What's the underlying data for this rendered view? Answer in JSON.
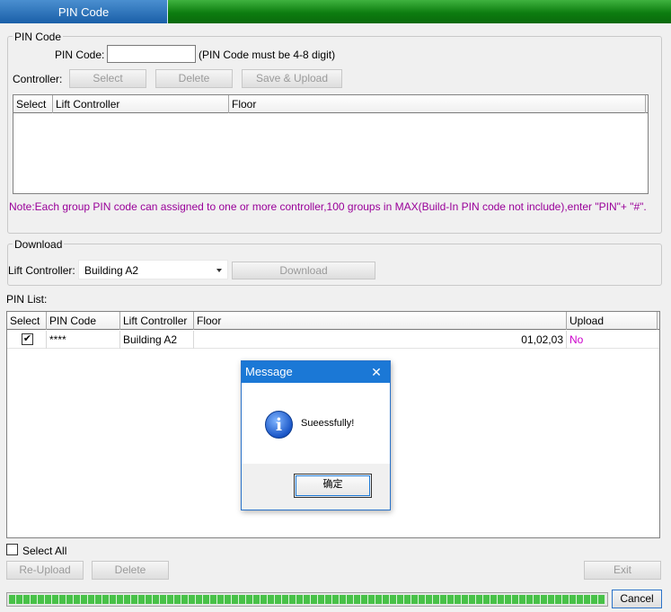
{
  "tab": {
    "label": "PIN Code"
  },
  "pin_group": {
    "title": "PIN Code",
    "pin_label": "PIN Code:",
    "pin_value": "",
    "hint": "(PIN Code must be 4-8 digit)",
    "controller_label": "Controller:",
    "select_button": "Select",
    "delete_button": "Delete",
    "save_upload_button": "Save & Upload",
    "columns": [
      "Select",
      "Lift Controller",
      "Floor"
    ],
    "note": "Note:Each group PIN code can assigned to one or more controller,100 groups in MAX(Build-In PIN code not include),enter \"PIN\"+ \"#\"."
  },
  "download_group": {
    "title": "Download",
    "lift_label": "Lift Controller:",
    "lift_value": "Building A2",
    "download_button": "Download"
  },
  "pin_list": {
    "label": "PIN List:",
    "columns": [
      "Select",
      "PIN Code",
      "Lift Controller",
      "Floor",
      "Upload"
    ],
    "rows": [
      {
        "checked": true,
        "check_glyph": "✔",
        "pin": "****",
        "controller": "Building A2",
        "floor": "01,02,03",
        "upload": "No"
      }
    ]
  },
  "footer": {
    "select_all": "Select All",
    "reupload_button": "Re-Upload",
    "delete_button": "Delete",
    "exit_button": "Exit",
    "cancel_button": "Cancel",
    "progress_fraction": 1.0
  },
  "dialog": {
    "title": "Message",
    "close_glyph": "✕",
    "icon_glyph": "i",
    "message": "Sueessfully!",
    "ok_button": "确定"
  },
  "colors": {
    "note_text": "#990099",
    "upload_no": "#cc00cc",
    "tab_active": "#1a5fa8",
    "tab_bar": "#0d7d10",
    "dialog_title": "#1b78d6"
  }
}
